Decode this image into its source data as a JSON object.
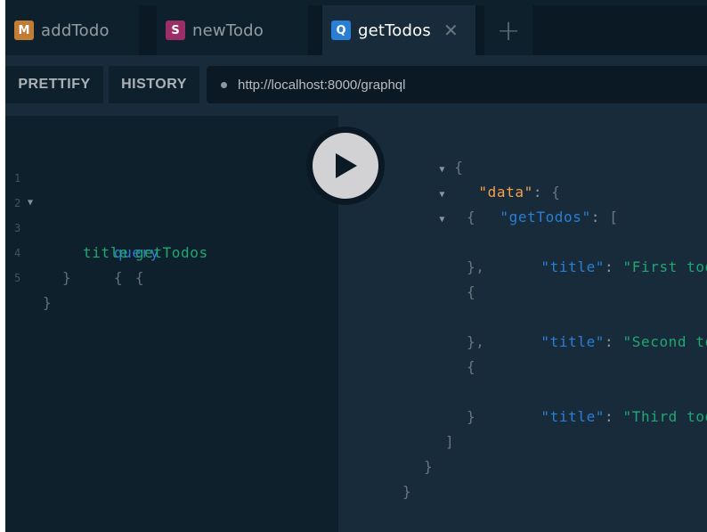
{
  "tabs": [
    {
      "badge": "M",
      "title": "addTodo",
      "color": "#c17c35"
    },
    {
      "badge": "S",
      "title": "newTodo",
      "color": "#9a2f68"
    },
    {
      "badge": "Q",
      "title": "getTodos",
      "color": "#2a7ed3",
      "active": true,
      "close": "✕"
    }
  ],
  "new_tab": "+",
  "toolbar": {
    "prettify": "PRETTIFY",
    "history": "HISTORY",
    "url": "http://localhost:8000/graphql"
  },
  "editor": {
    "line_numbers": [
      "1",
      "2",
      "3",
      "4",
      "5"
    ],
    "query_keyword": "query",
    "brace_open": "{",
    "field_getTodos": "getTodos",
    "field_title": "title",
    "brace_close": "}"
  },
  "result": {
    "brace_open": "{",
    "brace_close": "}",
    "key_data": "\"data\"",
    "key_getTodos": "\"getTodos\"",
    "key_title": "\"title\"",
    "colon": ":",
    "bracket_open": "[",
    "bracket_close": "]",
    "obj_close_comma": "},",
    "todos": [
      "\"First todo\"",
      "\"Second todo\"",
      "\"Third todo\""
    ]
  },
  "colors": {
    "query": "#2a7ed3",
    "field": "#1fa774",
    "data_key": "#f8a14b",
    "background": "#0f202d"
  }
}
